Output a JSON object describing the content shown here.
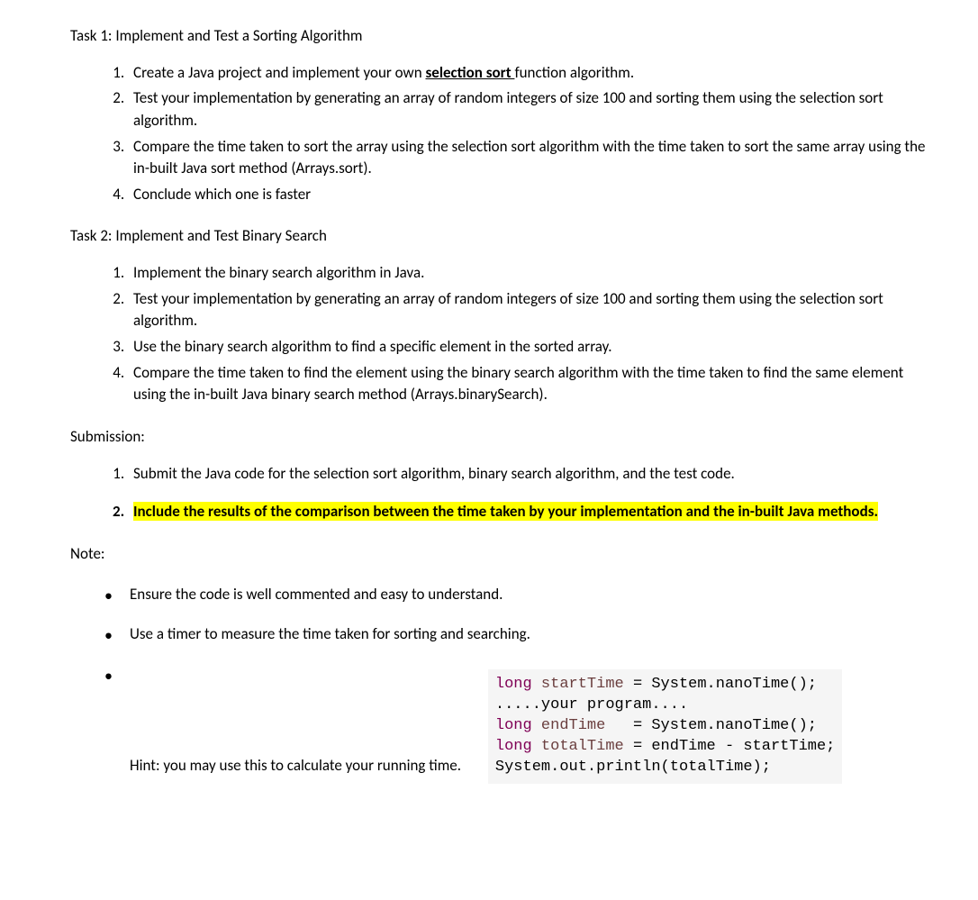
{
  "task1": {
    "title": "Task 1: Implement and Test a Sorting Algorithm",
    "items": [
      {
        "pre": "Create a Java project and implement your own ",
        "emph": "selection sort ",
        "post": " function algorithm."
      },
      {
        "text": "Test your implementation by generating an array of random integers of size 100 and sorting them using the selection sort algorithm."
      },
      {
        "text": "Compare the time taken to sort the array using the selection sort algorithm with the time taken to sort the same array using the in-built Java sort method (Arrays.sort)."
      },
      {
        "text": "Conclude which one is faster"
      }
    ]
  },
  "task2": {
    "title": "Task 2: Implement and Test Binary Search",
    "items": [
      "Implement the binary search algorithm in Java.",
      "Test your implementation by generating an array of random integers of size 100 and sorting them using the selection sort algorithm.",
      "Use the binary search algorithm to find a specific element in the sorted array.",
      "Compare the time taken to find the element using the binary search algorithm with the time taken to find the same element using the in-built Java binary search method (Arrays.binarySearch)."
    ]
  },
  "submission": {
    "label": "Submission:",
    "items": [
      "Submit the Java code for the selection sort algorithm, binary search algorithm, and the test code.",
      "Include the results of the comparison between the time taken by your implementation and the in-built Java methods."
    ]
  },
  "note": {
    "label": "Note:",
    "items": [
      "Ensure the code is well commented and easy to understand.",
      "Use a timer to measure the time taken for sorting and searching.",
      "Hint:  you may use this to calculate your running time."
    ]
  },
  "code": {
    "l1_kw": "long",
    "l1_var": " startTime ",
    "l1_rest": "= System.nanoTime();",
    "l2": ".....your program....",
    "l3_kw": "long",
    "l3_var": " endTime   ",
    "l3_rest": "= System.nanoTime();",
    "l4_kw": "long",
    "l4_var": " totalTime ",
    "l4_rest": "= endTime - startTime;",
    "l5": "System.out.println(totalTime);"
  }
}
